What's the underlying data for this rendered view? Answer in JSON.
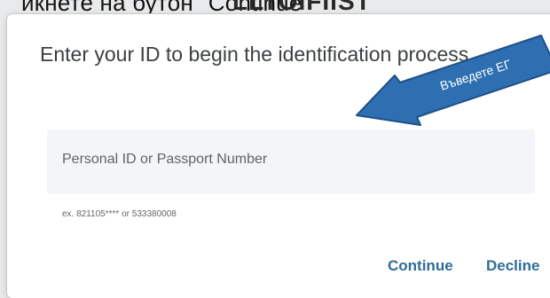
{
  "background": {
    "top_text": "икнете на бутон \"Continue\"",
    "page_heading": "LLTOIFIIST"
  },
  "dialog": {
    "title": "Enter your ID to begin the identification process",
    "input_placeholder": "Personal ID or Passport Number",
    "helper_text": "ex. 821105**** or 533380008",
    "continue_label": "Continue",
    "decline_label": "Decline"
  },
  "annotation": {
    "arrow_text": "Въведете ЕГ",
    "arrow_color": "#2e6fb2",
    "icon": "arrow-pointer-icon"
  },
  "colors": {
    "accent": "#2d6d97",
    "input_bg": "#f3f5f8"
  }
}
